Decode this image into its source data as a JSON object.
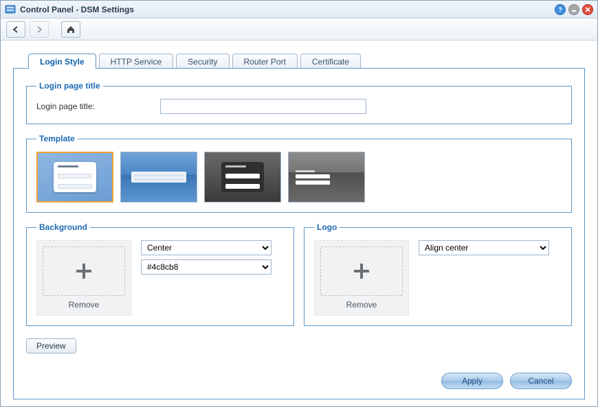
{
  "window": {
    "title": "Control Panel - DSM Settings"
  },
  "tabs": [
    {
      "label": "Login Style"
    },
    {
      "label": "HTTP Service"
    },
    {
      "label": "Security"
    },
    {
      "label": "Router Port"
    },
    {
      "label": "Certificate"
    }
  ],
  "login_title_section": {
    "legend": "Login page title",
    "label": "Login page title:",
    "value": ""
  },
  "template_section": {
    "legend": "Template"
  },
  "background_section": {
    "legend": "Background",
    "remove_label": "Remove",
    "position_value": "Center",
    "color_value": "#4c8cb8"
  },
  "logo_section": {
    "legend": "Logo",
    "remove_label": "Remove",
    "align_value": "Align center"
  },
  "buttons": {
    "preview": "Preview",
    "apply": "Apply",
    "cancel": "Cancel"
  }
}
